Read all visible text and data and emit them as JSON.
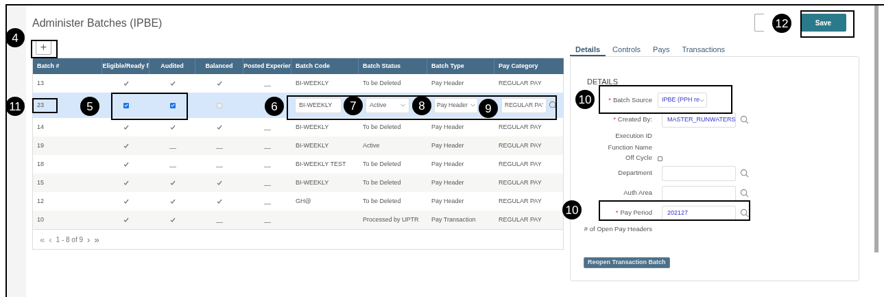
{
  "title": "Administer Batches (IPBE)",
  "add_button": {
    "label": "+"
  },
  "table": {
    "columns": [
      "Batch #",
      "Eligible/Ready f",
      "Audited",
      "Balanced",
      "Posted Experier",
      "Batch Code",
      "Batch Status",
      "Batch Type",
      "Pay Category"
    ],
    "rows": [
      {
        "kind": "view",
        "selected": false,
        "batch": "13",
        "eligible": true,
        "audited": true,
        "balanced": true,
        "posted": false,
        "code": "BI-WEEKLY",
        "status": "To be Deleted",
        "type": "Pay Header",
        "category": "REGULAR PAY"
      },
      {
        "kind": "edit",
        "selected": true,
        "batch": "23",
        "eligible": true,
        "audited": true,
        "balanced": false,
        "code": "BI-WEEKLY",
        "status": "Active",
        "type": "Pay Header",
        "category": "REGULAR PA'"
      },
      {
        "kind": "view",
        "selected": false,
        "batch": "14",
        "eligible": true,
        "audited": true,
        "balanced": true,
        "posted": false,
        "code": "BI-WEEKLY",
        "status": "To be Deleted",
        "type": "Pay Header",
        "category": "REGULAR PAY"
      },
      {
        "kind": "view",
        "selected": false,
        "batch": "19",
        "eligible": true,
        "audited": false,
        "balanced": false,
        "posted": false,
        "code": "BI-WEEKLY",
        "status": "Active",
        "type": "Pay Header",
        "category": "REGULAR PAY"
      },
      {
        "kind": "view",
        "selected": false,
        "batch": "18",
        "eligible": true,
        "audited": false,
        "balanced": false,
        "posted": false,
        "code": "BI-WEEKLY TEST",
        "status": "To be Deleted",
        "type": "Pay Header",
        "category": "REGULAR PAY"
      },
      {
        "kind": "view",
        "selected": false,
        "batch": "15",
        "eligible": true,
        "audited": true,
        "balanced": true,
        "posted": false,
        "code": "BI-WEEKLY",
        "status": "To be Deleted",
        "type": "Pay Header",
        "category": "REGULAR PAY"
      },
      {
        "kind": "view",
        "selected": false,
        "batch": "12",
        "eligible": true,
        "audited": true,
        "balanced": true,
        "posted": false,
        "code": "GH@",
        "status": "To be Deleted",
        "type": "Pay Header",
        "category": "REGULAR PAY"
      },
      {
        "kind": "view",
        "selected": false,
        "batch": "10",
        "eligible": true,
        "audited": true,
        "balanced": false,
        "posted": false,
        "code": "",
        "status": "Processed by UPTR",
        "type": "Pay Transaction",
        "category": "REGULAR PAY"
      }
    ],
    "pagination": {
      "first": "«",
      "prev": "‹",
      "range": "1 - 8 of 9",
      "next": "›",
      "last": "»"
    }
  },
  "save_button": "Save",
  "tabs": [
    {
      "label": "Details",
      "selected": true
    },
    {
      "label": "Controls",
      "selected": false
    },
    {
      "label": "Pays",
      "selected": false
    },
    {
      "label": "Transactions",
      "selected": false
    }
  ],
  "details": {
    "heading": "DETAILS",
    "fields": [
      {
        "kind": "select",
        "label": "Batch Source",
        "required_mark": "*",
        "value": "IPBE (PPH re"
      },
      {
        "kind": "lookup",
        "label": "Created By:",
        "required_mark": "*",
        "value": "MASTER_RUNWATERS"
      },
      {
        "kind": "text",
        "label": "Execution ID"
      },
      {
        "kind": "text",
        "label": "Function Name"
      },
      {
        "kind": "checkbox",
        "label": "Off Cycle",
        "checked": false
      },
      {
        "kind": "lookup",
        "label": "Department"
      },
      {
        "kind": "lookup",
        "label": "Auth Area"
      },
      {
        "kind": "lookup",
        "label": "Pay Period",
        "required_mark": "*",
        "value": "202127"
      },
      {
        "kind": "text",
        "label": "# of Open Pay Headers"
      }
    ],
    "reopen_button": "Reopen Transaction Batch"
  },
  "annotations": [
    {
      "label": "4"
    },
    {
      "label": "11"
    },
    {
      "label": "5"
    },
    {
      "label": "6"
    },
    {
      "label": "7"
    },
    {
      "label": "8"
    },
    {
      "label": "9"
    },
    {
      "label": "10"
    },
    {
      "label": "10"
    },
    {
      "label": "12"
    }
  ]
}
